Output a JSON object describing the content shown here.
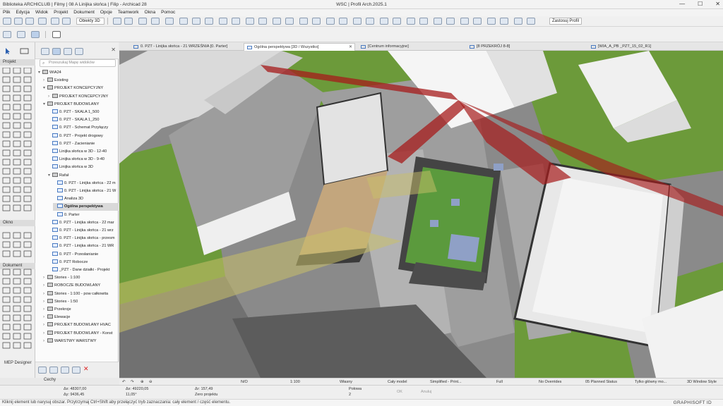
{
  "window": {
    "title_left": "Biblioteka ARCHICLUB | Filmy | 08 A Linijka słońca | Filip - Archicad 28",
    "title_center": "WSC | Profil Arch.2025.1",
    "btn_min": "—",
    "btn_max": "☐",
    "btn_close": "✕"
  },
  "menu": [
    "Plik",
    "Edycja",
    "Widok",
    "Projekt",
    "Dokument",
    "Opcje",
    "Teamwork",
    "Okna",
    "Pomoc"
  ],
  "toolbar": {
    "view_dropdown": "Obiekty 3D",
    "profile_dropdown": "Zastosuj Profil"
  },
  "toolbox": {
    "sections": [
      "Projekt",
      "Okno",
      "Dokument"
    ]
  },
  "navigator": {
    "search_placeholder": "Przeszukaj Mapę widoków",
    "mep_label": "MEP Designer",
    "tree": [
      {
        "label": "WIA24",
        "depth": 0,
        "type": "folder",
        "arrow": "▾"
      },
      {
        "label": "Existing",
        "depth": 1,
        "type": "folder",
        "arrow": "›"
      },
      {
        "label": "PROJEKT KONCEPCYJNY",
        "depth": 1,
        "type": "folder",
        "arrow": "▾"
      },
      {
        "label": "PROJEKT KONCEPCYJNY",
        "depth": 2,
        "type": "folder",
        "arrow": "›"
      },
      {
        "label": "PROJEKT BUDOWLANY",
        "depth": 1,
        "type": "folder",
        "arrow": "▾"
      },
      {
        "label": "0. PZT - SKALA 1_500",
        "depth": 2,
        "type": "view",
        "arrow": ""
      },
      {
        "label": "0. PZT - SKALA 1_250",
        "depth": 2,
        "type": "view",
        "arrow": ""
      },
      {
        "label": "0. PZT - Schemat Przyłączy",
        "depth": 2,
        "type": "view",
        "arrow": ""
      },
      {
        "label": "0. PZT - Projekt drogowy",
        "depth": 2,
        "type": "view",
        "arrow": ""
      },
      {
        "label": "0. PZT - Zacienianie",
        "depth": 2,
        "type": "view",
        "arrow": ""
      },
      {
        "label": "Linijka słońca w 3D - 12-40",
        "depth": 2,
        "type": "view",
        "arrow": ""
      },
      {
        "label": "Linijka słońca w 3D - 9-40",
        "depth": 2,
        "type": "view",
        "arrow": ""
      },
      {
        "label": "Linijka słońca w 3D",
        "depth": 2,
        "type": "view",
        "arrow": ""
      },
      {
        "label": "Rafał",
        "depth": 2,
        "type": "folder",
        "arrow": "▾"
      },
      {
        "label": "0. PZT - Linijka słońca - 22 m",
        "depth": 3,
        "type": "view",
        "arrow": ""
      },
      {
        "label": "0. PZT - Linijka słońca - 21 W",
        "depth": 3,
        "type": "view",
        "arrow": ""
      },
      {
        "label": "Analiza 3D",
        "depth": 3,
        "type": "view",
        "arrow": ""
      },
      {
        "label": "Ogólna perspektywa",
        "depth": 3,
        "type": "view",
        "arrow": "",
        "selected": true
      },
      {
        "label": "0. Parter",
        "depth": 3,
        "type": "view",
        "arrow": ""
      },
      {
        "label": "0. PZT - Linijka słońca - 22 mar",
        "depth": 2,
        "type": "view",
        "arrow": ""
      },
      {
        "label": "0. PZT - Linijka słońca - 21 wrz",
        "depth": 2,
        "type": "view",
        "arrow": ""
      },
      {
        "label": "0. PZT - Linijka słońca - przesm",
        "depth": 2,
        "type": "view",
        "arrow": ""
      },
      {
        "label": "0. PZT - Linijka słońca - 21 WR",
        "depth": 2,
        "type": "view",
        "arrow": ""
      },
      {
        "label": "0. PZT - Przesłanianie",
        "depth": 2,
        "type": "view",
        "arrow": ""
      },
      {
        "label": "0. PZT Robocze",
        "depth": 2,
        "type": "view",
        "arrow": ""
      },
      {
        "label": "_PZT - Dane działki - Projekt",
        "depth": 2,
        "type": "view",
        "arrow": ""
      },
      {
        "label": "Stories - 1:100",
        "depth": 1,
        "type": "folder",
        "arrow": "›"
      },
      {
        "label": "ROBOCZE BUDOWLANY",
        "depth": 1,
        "type": "folder",
        "arrow": "›"
      },
      {
        "label": "Stories - 1:100 - pow całkowita",
        "depth": 1,
        "type": "folder",
        "arrow": "›"
      },
      {
        "label": "Stories - 1:50",
        "depth": 1,
        "type": "folder",
        "arrow": "›"
      },
      {
        "label": "Przekroje",
        "depth": 1,
        "type": "folder",
        "arrow": "›"
      },
      {
        "label": "Elewacje",
        "depth": 1,
        "type": "folder",
        "arrow": "›"
      },
      {
        "label": "PROJEKT BUDOWLANY HVAC",
        "depth": 1,
        "type": "folder",
        "arrow": "›"
      },
      {
        "label": "PROJEKT BUDOWLANY - Konst",
        "depth": 1,
        "type": "folder",
        "arrow": "›"
      },
      {
        "label": "WARSTWY WARSTWY",
        "depth": 1,
        "type": "folder",
        "arrow": "›"
      }
    ],
    "bottom_label": "Cechy"
  },
  "tabs": [
    {
      "label": "0. PZT - Linijka słońca - 21 WRZEŚNIA [0. Parter]",
      "active": false
    },
    {
      "label": "Ogólna perspektywa [3D / Wszystko]",
      "active": true
    },
    {
      "label": "[Centrum informacyjne]",
      "active": false
    },
    {
      "label": "[8 PRZEKRÓJ 8-8]",
      "active": false
    },
    {
      "label": "[WIA_A_PB _PZT_15_02_R1]",
      "active": false
    }
  ],
  "bottom_bar": {
    "scale": "1:100",
    "pen_set": "Własny",
    "model": "Cały model",
    "mvo": "Simplified - Print...",
    "full": "Full",
    "overrides": "No Overrides",
    "status": "05 Planned Status",
    "style": "Tylko główny mo...",
    "window_style": "3D Window Style",
    "na": "N/O"
  },
  "info_box": {
    "ax": "48307,00",
    "ay": "9436,45",
    "dx": "49220,05",
    "angle": "11,05°",
    "ar": "157,49",
    "zero": "Zero projektu",
    "half": "Połowa",
    "half_val": "2",
    "ok": "OK",
    "cancel": "Anuluj"
  },
  "status": {
    "message": "Kliknij element lub narysuj obszar. Przytrzymaj Ctrl+Shift aby przełączyć tryb zaznaczania: cały element / część elementu.",
    "brand": "GRAPHISOFT ID"
  },
  "colors": {
    "grass": "#6c9a3a",
    "roof": "#e9e9e9",
    "wall": "#f2f2f2",
    "sun_shadow": "#c9c06a",
    "red_ray": "#a61b1b"
  }
}
